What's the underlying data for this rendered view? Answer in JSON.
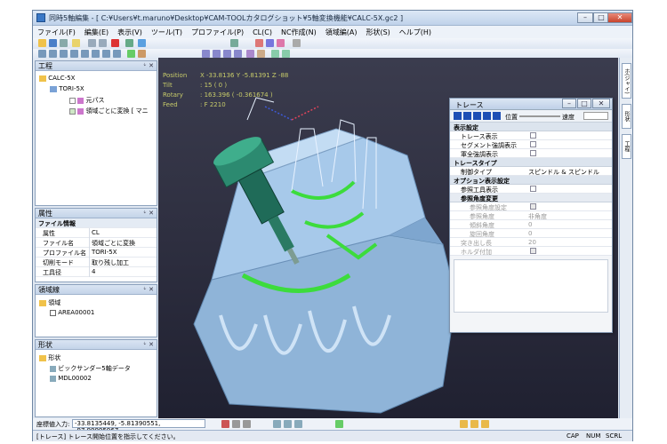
{
  "window": {
    "title": "同時5軸編集 - [ C:¥Users¥t.maruno¥Desktop¥CAM-TOOLカタログショット¥5軸変換機能¥CALC-5X.gc2 ]"
  },
  "menu": [
    "ファイル(F)",
    "編集(E)",
    "表示(V)",
    "ツール(T)",
    "プロファイル(P)",
    "CL(C)",
    "NC作成(N)",
    "領域編(A)",
    "形状(S)",
    "ヘルプ(H)"
  ],
  "panels": {
    "process": {
      "title": "工程",
      "root": "CALC-5X",
      "child": "TORI-5X",
      "items": [
        "元パス",
        "領域ごとに変換 [ マニ"
      ]
    },
    "attributes": {
      "title": "属性",
      "section": "ファイル情報",
      "rows": [
        {
          "k": "属性",
          "v": "CL"
        },
        {
          "k": "ファイル名",
          "v": "領域ごとに変換"
        },
        {
          "k": "プロファイル名",
          "v": "TORI-5X"
        },
        {
          "k": "切削モード",
          "v": "取り残し加工"
        },
        {
          "k": "工具径",
          "v": "4"
        }
      ]
    },
    "area": {
      "title": "領域線",
      "root": "領域",
      "child": "AREA00001"
    },
    "shape": {
      "title": "形状",
      "root": "形状",
      "child": "ビックサンダー5軸データ",
      "child2": "MDL00002"
    }
  },
  "readout": {
    "position": {
      "label": "Position",
      "value": "X -33.8136  Y -5.81391  Z -88"
    },
    "tilt": {
      "label": "Tilt",
      "value": ":  15  ( 0 )"
    },
    "rotary": {
      "label": "Rotary",
      "value": ":  163.396  ( -0.361674 )"
    },
    "feed": {
      "label": "Feed",
      "value": ":  F 2210"
    }
  },
  "trace": {
    "title": "トレース",
    "position_label": "位置",
    "speed_label": "速度",
    "sections": {
      "display": "表示設定",
      "trace_type": "トレースタイプ",
      "option": "オプション表示設定",
      "angle_change": "参照角度変更"
    },
    "rows": {
      "trace_show": "トレース表示",
      "segment_highlight": "セグメント強調表示",
      "interference_highlight": "軍全強調表示",
      "controller_type": "制御タイプ",
      "controller_value": "スピンドル & スピンドル",
      "reference_tool": "参照工具表示",
      "ref_angle_set": "参照角度設定",
      "ref_angle": "参照角度",
      "ref_angle_val": "非角度",
      "tilt_angle": "傾斜角度",
      "tilt_angle_val": "0",
      "rot_angle": "旋回角度",
      "rot_angle_val": "0",
      "protrusion": "突き出し長",
      "protrusion_val": "20",
      "holder": "ホルダ付加"
    }
  },
  "right_tabs": [
    "ホ(ジャイ)",
    "形状",
    "工程"
  ],
  "coord": {
    "label": "座標値入力:",
    "value": "-33.8135449, -5.81390551, -97.99995967"
  },
  "status": {
    "message": "[トレース] トレース開始位置を指示してください。",
    "caps": "CAP",
    "num": "NUM",
    "scrl": "SCRL"
  },
  "colors": {
    "toolpath_green": "#3cdc3c",
    "model_blue": "#9fc4e6",
    "tool_green": "#1f6b58"
  }
}
